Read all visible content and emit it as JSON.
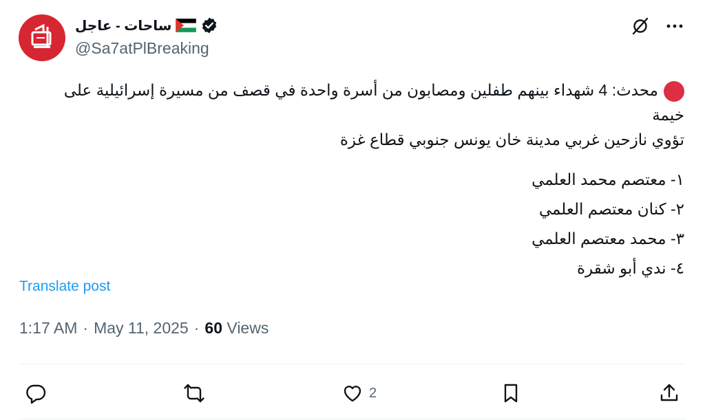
{
  "author": {
    "display_name": "ساحات - عاجل",
    "handle": "@Sa7atPlBreaking",
    "avatar_icon": "sahat-logo",
    "verified_icon": "verified-badge-icon",
    "flag_icon": "palestine-flag-icon"
  },
  "colors": {
    "avatar_bg": "#d62631",
    "link": "#1d9bf0",
    "secondary_text": "#536471",
    "primary_text": "#0f1419",
    "red_dot": "#dd2e44"
  },
  "tweet": {
    "line1": "محدث: 4 شهداء بينهم طفلين ومصابون من أسرة واحدة في قصف من مسيرة إسرائيلية على خيمة",
    "line2": "تؤوي نازحين غربي مدينة خان يونس جنوبي قطاع غزة",
    "names": [
      "١- معتصم محمد العلمي",
      "٢- كنان معتصم العلمي",
      "٣- محمد معتصم العلمي",
      "٤- ندي أبو شقرة"
    ]
  },
  "translate_label": "Translate post",
  "meta": {
    "time": "1:17 AM",
    "sep1": "·",
    "date": "May 11, 2025",
    "sep2": "·",
    "views_count": "60",
    "views_label": "Views"
  },
  "actions": {
    "reply_count": "",
    "repost_count": "",
    "like_count": "2",
    "bookmark_count": ""
  },
  "icons": [
    "grok-icon",
    "more-icon",
    "reply-icon",
    "repost-icon",
    "like-icon",
    "bookmark-icon",
    "share-icon"
  ]
}
